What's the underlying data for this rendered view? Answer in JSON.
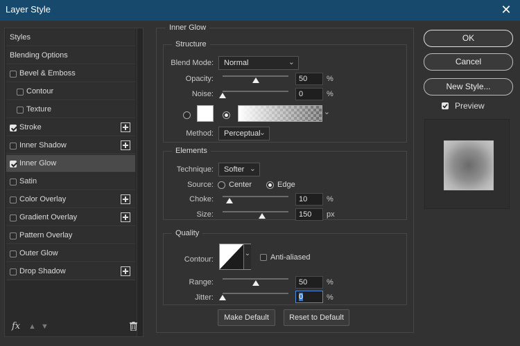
{
  "window": {
    "title": "Layer Style"
  },
  "styles_list": [
    {
      "label": "Styles",
      "checkbox": false,
      "indent": false,
      "plus": false,
      "selected": false
    },
    {
      "label": "Blending Options",
      "checkbox": false,
      "indent": false,
      "plus": false,
      "selected": false
    },
    {
      "label": "Bevel & Emboss",
      "checkbox": true,
      "checked": false,
      "indent": false,
      "plus": false
    },
    {
      "label": "Contour",
      "checkbox": true,
      "checked": false,
      "indent": true,
      "plus": false
    },
    {
      "label": "Texture",
      "checkbox": true,
      "checked": false,
      "indent": true,
      "plus": false
    },
    {
      "label": "Stroke",
      "checkbox": true,
      "checked": true,
      "indent": false,
      "plus": true
    },
    {
      "label": "Inner Shadow",
      "checkbox": true,
      "checked": false,
      "indent": false,
      "plus": true
    },
    {
      "label": "Inner Glow",
      "checkbox": true,
      "checked": true,
      "indent": false,
      "plus": false,
      "selected": true
    },
    {
      "label": "Satin",
      "checkbox": true,
      "checked": false,
      "indent": false,
      "plus": false
    },
    {
      "label": "Color Overlay",
      "checkbox": true,
      "checked": false,
      "indent": false,
      "plus": true
    },
    {
      "label": "Gradient Overlay",
      "checkbox": true,
      "checked": false,
      "indent": false,
      "plus": true
    },
    {
      "label": "Pattern Overlay",
      "checkbox": true,
      "checked": false,
      "indent": false,
      "plus": false
    },
    {
      "label": "Outer Glow",
      "checkbox": true,
      "checked": false,
      "indent": false,
      "plus": false
    },
    {
      "label": "Drop Shadow",
      "checkbox": true,
      "checked": false,
      "indent": false,
      "plus": true
    }
  ],
  "left_footer": {
    "fx_label": "fx"
  },
  "inner_glow": {
    "title": "Inner Glow",
    "structure": {
      "title": "Structure",
      "blend_mode_label": "Blend Mode:",
      "blend_mode_value": "Normal",
      "opacity_label": "Opacity:",
      "opacity_value": "50",
      "opacity_unit": "%",
      "opacity_fraction": 0.5,
      "noise_label": "Noise:",
      "noise_value": "0",
      "noise_unit": "%",
      "noise_fraction": 0.0,
      "color_swatch": "#ffffff",
      "method_label": "Method:",
      "method_value": "Perceptual"
    },
    "elements": {
      "title": "Elements",
      "technique_label": "Technique:",
      "technique_value": "Softer",
      "source_label": "Source:",
      "source_center": "Center",
      "source_edge": "Edge",
      "choke_label": "Choke:",
      "choke_value": "10",
      "choke_unit": "%",
      "choke_fraction": 0.1,
      "size_label": "Size:",
      "size_value": "150",
      "size_unit": "px",
      "size_fraction": 0.6
    },
    "quality": {
      "title": "Quality",
      "contour_label": "Contour:",
      "anti_aliased_label": "Anti-aliased",
      "range_label": "Range:",
      "range_value": "50",
      "range_unit": "%",
      "range_fraction": 0.5,
      "jitter_label": "Jitter:",
      "jitter_value": "0",
      "jitter_unit": "%",
      "jitter_fraction": 0.0
    },
    "make_default": "Make Default",
    "reset_default": "Reset to Default"
  },
  "right_buttons": {
    "ok": "OK",
    "cancel": "Cancel",
    "new_style": "New Style...",
    "preview_label": "Preview"
  }
}
